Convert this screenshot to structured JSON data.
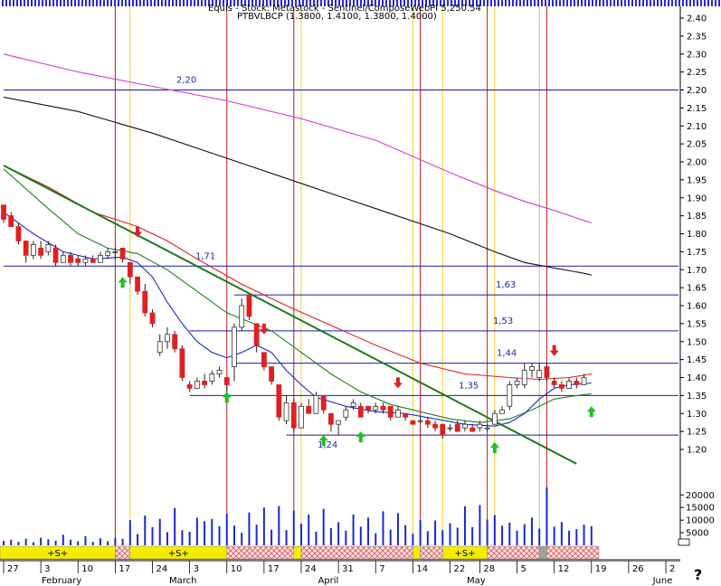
{
  "header": {
    "line1": "Equis - Stock: Metastock - Sentinel/ComposeWebPI 5,250.54",
    "line2": "PTBVLBCP (1.3800, 1.4100, 1.3800, 1.4000)"
  },
  "colors": {
    "background": "#ffffff",
    "up_candle": "#2a3cc0",
    "down_candle": "#e02020",
    "hline": "#1a1aa0",
    "ma_magenta": "#d040d0",
    "ma_black": "#101030",
    "ma_red": "#e02020",
    "ma_green": "#1f7f1f",
    "ma_blue": "#1a2ad0",
    "trendline": "#1e7a1e",
    "vline_red": "#c01818",
    "vline_yellow": "#f0d020",
    "volume": "#1a2ad0",
    "band_yellow": "#f4ec00",
    "band_hatch": "#e06060",
    "arrow_up": "#20c020",
    "arrow_down": "#e02020"
  },
  "chart_data": {
    "type": "candlestick",
    "title": "",
    "xlabel": "",
    "ylabel": "",
    "price_ylim": [
      1.15,
      2.45
    ],
    "price_ticks": [
      "2.40",
      "2.35",
      "2.30",
      "2.25",
      "2.20",
      "2.15",
      "2.10",
      "2.05",
      "2.00",
      "1.95",
      "1.90",
      "1.85",
      "1.80",
      "1.75",
      "1.70",
      "1.65",
      "1.60",
      "1.55",
      "1.50",
      "1.45",
      "1.40",
      "1.35",
      "1.30",
      "1.25",
      "1.20"
    ],
    "volume_ticks": [
      "20000",
      "15000",
      "10000",
      "5000"
    ],
    "volume_ylim": [
      0,
      28000
    ],
    "volume_tick_values": [
      20000,
      15000,
      10000,
      5000
    ],
    "x_day_labels": [
      "27",
      "3",
      "10",
      "17",
      "24",
      "3",
      "10",
      "17",
      "24",
      "31",
      "7",
      "14",
      "22",
      "28",
      "5",
      "12",
      "19",
      "26",
      "2"
    ],
    "x_day_index": [
      0,
      5,
      10,
      15,
      20,
      25,
      30,
      35,
      40,
      45,
      50,
      55,
      60,
      64,
      69,
      74,
      79,
      84,
      89
    ],
    "x_month_labels": [
      "February",
      "March",
      "April",
      "May",
      "June"
    ],
    "x_month_index": [
      2,
      22,
      42,
      62,
      87
    ],
    "n_slots": 92,
    "horizontal_levels": [
      {
        "value": 2.2,
        "label": "2,20",
        "from_index": 0
      },
      {
        "value": 1.71,
        "label": "1,71",
        "from_index": 0
      },
      {
        "value": 1.63,
        "label": "1,63",
        "from_index": 31
      },
      {
        "value": 1.53,
        "label": "1,53",
        "from_index": 25
      },
      {
        "value": 1.44,
        "label": "1,44",
        "from_index": 31
      },
      {
        "value": 1.35,
        "label": "1,35",
        "from_index": 25
      },
      {
        "value": 1.24,
        "label": "1,24",
        "from_index": 38
      }
    ],
    "ohlc": [
      [
        1.88,
        1.88,
        1.83,
        1.84
      ],
      [
        1.85,
        1.86,
        1.82,
        1.82
      ],
      [
        1.82,
        1.83,
        1.77,
        1.78
      ],
      [
        1.78,
        1.78,
        1.72,
        1.74
      ],
      [
        1.74,
        1.78,
        1.73,
        1.77
      ],
      [
        1.76,
        1.78,
        1.73,
        1.74
      ],
      [
        1.75,
        1.78,
        1.74,
        1.77
      ],
      [
        1.76,
        1.77,
        1.71,
        1.72
      ],
      [
        1.72,
        1.75,
        1.72,
        1.74
      ],
      [
        1.74,
        1.75,
        1.71,
        1.72
      ],
      [
        1.73,
        1.74,
        1.71,
        1.72
      ],
      [
        1.72,
        1.74,
        1.71,
        1.73
      ],
      [
        1.73,
        1.74,
        1.72,
        1.72
      ],
      [
        1.72,
        1.75,
        1.72,
        1.74
      ],
      [
        1.74,
        1.76,
        1.73,
        1.75
      ],
      [
        1.75,
        1.76,
        1.73,
        1.75
      ],
      [
        1.76,
        1.76,
        1.72,
        1.73
      ],
      [
        1.72,
        1.72,
        1.66,
        1.68
      ],
      [
        1.68,
        1.68,
        1.63,
        1.64
      ],
      [
        1.64,
        1.66,
        1.57,
        1.58
      ],
      [
        1.58,
        1.59,
        1.54,
        1.55
      ],
      [
        1.47,
        1.52,
        1.46,
        1.5
      ],
      [
        1.5,
        1.54,
        1.48,
        1.52
      ],
      [
        1.52,
        1.53,
        1.47,
        1.48
      ],
      [
        1.48,
        1.49,
        1.39,
        1.4
      ],
      [
        1.38,
        1.39,
        1.36,
        1.37
      ],
      [
        1.37,
        1.4,
        1.37,
        1.39
      ],
      [
        1.39,
        1.41,
        1.37,
        1.38
      ],
      [
        1.39,
        1.42,
        1.38,
        1.41
      ],
      [
        1.41,
        1.43,
        1.4,
        1.42
      ],
      [
        1.4,
        1.4,
        1.36,
        1.38
      ],
      [
        1.43,
        1.55,
        1.39,
        1.54
      ],
      [
        1.54,
        1.62,
        1.53,
        1.6
      ],
      [
        1.63,
        1.63,
        1.56,
        1.57
      ],
      [
        1.55,
        1.55,
        1.47,
        1.49
      ],
      [
        1.47,
        1.47,
        1.42,
        1.43
      ],
      [
        1.43,
        1.43,
        1.38,
        1.39
      ],
      [
        1.38,
        1.38,
        1.28,
        1.29
      ],
      [
        1.28,
        1.35,
        1.27,
        1.33
      ],
      [
        1.33,
        1.34,
        1.25,
        1.26
      ],
      [
        1.26,
        1.33,
        1.26,
        1.32
      ],
      [
        1.32,
        1.34,
        1.3,
        1.3
      ],
      [
        1.3,
        1.36,
        1.3,
        1.35
      ],
      [
        1.35,
        1.35,
        1.3,
        1.31
      ],
      [
        1.3,
        1.3,
        1.25,
        1.27
      ],
      [
        1.27,
        1.28,
        1.24,
        1.28
      ],
      [
        1.29,
        1.32,
        1.28,
        1.31
      ],
      [
        1.32,
        1.34,
        1.31,
        1.33
      ],
      [
        1.32,
        1.33,
        1.29,
        1.29
      ],
      [
        1.32,
        1.32,
        1.3,
        1.31
      ],
      [
        1.31,
        1.33,
        1.3,
        1.32
      ],
      [
        1.32,
        1.33,
        1.3,
        1.31
      ],
      [
        1.32,
        1.32,
        1.28,
        1.29
      ],
      [
        1.29,
        1.32,
        1.29,
        1.31
      ],
      [
        1.3,
        1.3,
        1.28,
        1.29
      ],
      [
        1.28,
        1.28,
        1.27,
        1.27
      ],
      [
        1.28,
        1.29,
        1.27,
        1.28
      ],
      [
        1.28,
        1.29,
        1.26,
        1.27
      ],
      [
        1.27,
        1.28,
        1.25,
        1.26
      ],
      [
        1.27,
        1.27,
        1.23,
        1.24
      ],
      [
        1.26,
        1.27,
        1.25,
        1.26
      ],
      [
        1.27,
        1.28,
        1.25,
        1.25
      ],
      [
        1.26,
        1.28,
        1.25,
        1.27
      ],
      [
        1.26,
        1.27,
        1.25,
        1.25
      ],
      [
        1.26,
        1.28,
        1.25,
        1.27
      ],
      [
        1.26,
        1.27,
        1.25,
        1.26
      ],
      [
        1.27,
        1.31,
        1.27,
        1.3
      ],
      [
        1.3,
        1.32,
        1.3,
        1.31
      ],
      [
        1.32,
        1.39,
        1.31,
        1.38
      ],
      [
        1.38,
        1.4,
        1.37,
        1.39
      ],
      [
        1.38,
        1.44,
        1.37,
        1.42
      ],
      [
        1.42,
        1.44,
        1.4,
        1.43
      ],
      [
        1.4,
        1.44,
        1.39,
        1.42
      ],
      [
        1.43,
        1.44,
        1.39,
        1.4
      ],
      [
        1.39,
        1.4,
        1.37,
        1.38
      ],
      [
        1.38,
        1.39,
        1.36,
        1.37
      ],
      [
        1.37,
        1.4,
        1.37,
        1.39
      ],
      [
        1.39,
        1.4,
        1.37,
        1.38
      ],
      [
        1.38,
        1.41,
        1.38,
        1.4
      ]
    ],
    "volume": [
      1800,
      2200,
      1400,
      2600,
      1200,
      3000,
      2400,
      1800,
      4200,
      2200,
      1600,
      3600,
      1400,
      2800,
      1600,
      3000,
      2600,
      10000,
      4500,
      11800,
      7200,
      10500,
      5200,
      14800,
      6000,
      5400,
      11000,
      9600,
      10500,
      7600,
      12500,
      7800,
      5000,
      13000,
      8200,
      15000,
      6200,
      15600,
      6000,
      13800,
      8600,
      12200,
      5400,
      14500,
      6800,
      9200,
      5800,
      12200,
      7400,
      11000,
      4800,
      13500,
      6200,
      12800,
      8000,
      4600,
      10000,
      5600,
      9800,
      6000,
      8800,
      7000,
      15500,
      7200,
      16000,
      10200,
      12000,
      7800,
      9000,
      5800,
      8400,
      11000,
      6600,
      23000,
      7400,
      9200,
      5800,
      6400,
      8200,
      7600
    ],
    "sma_short": [
      [
        0,
        1.86
      ],
      [
        4,
        1.8
      ],
      [
        8,
        1.75
      ],
      [
        12,
        1.73
      ],
      [
        16,
        1.735
      ],
      [
        18,
        1.72
      ],
      [
        20,
        1.68
      ],
      [
        22,
        1.61
      ],
      [
        24,
        1.55
      ],
      [
        26,
        1.5
      ],
      [
        28,
        1.47
      ],
      [
        30,
        1.455
      ],
      [
        32,
        1.47
      ],
      [
        34,
        1.49
      ],
      [
        36,
        1.47
      ],
      [
        38,
        1.42
      ],
      [
        40,
        1.38
      ],
      [
        42,
        1.345
      ],
      [
        46,
        1.32
      ],
      [
        50,
        1.305
      ],
      [
        54,
        1.3
      ],
      [
        58,
        1.285
      ],
      [
        62,
        1.27
      ],
      [
        66,
        1.265
      ],
      [
        68,
        1.275
      ],
      [
        70,
        1.3
      ],
      [
        72,
        1.34
      ],
      [
        74,
        1.37
      ],
      [
        76,
        1.38
      ],
      [
        79,
        1.385
      ]
    ],
    "sma_mid": [
      [
        0,
        1.98
      ],
      [
        6,
        1.87
      ],
      [
        10,
        1.8
      ],
      [
        14,
        1.76
      ],
      [
        18,
        1.745
      ],
      [
        22,
        1.7
      ],
      [
        26,
        1.64
      ],
      [
        30,
        1.58
      ],
      [
        33,
        1.555
      ],
      [
        36,
        1.53
      ],
      [
        40,
        1.47
      ],
      [
        44,
        1.41
      ],
      [
        48,
        1.36
      ],
      [
        52,
        1.325
      ],
      [
        56,
        1.305
      ],
      [
        60,
        1.285
      ],
      [
        64,
        1.275
      ],
      [
        68,
        1.285
      ],
      [
        71,
        1.31
      ],
      [
        74,
        1.34
      ],
      [
        77,
        1.35
      ],
      [
        79,
        1.355
      ]
    ],
    "sma_long": [
      [
        0,
        1.99
      ],
      [
        6,
        1.93
      ],
      [
        12,
        1.86
      ],
      [
        18,
        1.82
      ],
      [
        22,
        1.78
      ],
      [
        26,
        1.73
      ],
      [
        32,
        1.66
      ],
      [
        38,
        1.6
      ],
      [
        44,
        1.545
      ],
      [
        50,
        1.49
      ],
      [
        56,
        1.44
      ],
      [
        62,
        1.41
      ],
      [
        68,
        1.4
      ],
      [
        72,
        1.395
      ],
      [
        76,
        1.4
      ],
      [
        79,
        1.41
      ]
    ],
    "sma_150": [
      [
        0,
        2.18
      ],
      [
        10,
        2.14
      ],
      [
        20,
        2.08
      ],
      [
        30,
        2.01
      ],
      [
        40,
        1.94
      ],
      [
        50,
        1.87
      ],
      [
        60,
        1.8
      ],
      [
        66,
        1.75
      ],
      [
        70,
        1.72
      ],
      [
        74,
        1.705
      ],
      [
        78,
        1.69
      ],
      [
        79,
        1.685
      ]
    ],
    "sma_200": [
      [
        0,
        2.3
      ],
      [
        10,
        2.25
      ],
      [
        20,
        2.21
      ],
      [
        30,
        2.17
      ],
      [
        40,
        2.12
      ],
      [
        50,
        2.06
      ],
      [
        60,
        1.97
      ],
      [
        66,
        1.92
      ],
      [
        70,
        1.89
      ],
      [
        74,
        1.865
      ],
      [
        79,
        1.83
      ]
    ],
    "trendline": [
      [
        0,
        1.99
      ],
      [
        77,
        1.16
      ]
    ],
    "vlines_red": [
      15,
      30,
      39,
      56,
      65,
      73
    ],
    "vlines_yellow": [
      17,
      40,
      55,
      59,
      66
    ],
    "vlines_gray": [
      72
    ],
    "arrows_up": [
      [
        16,
        1.68
      ],
      [
        30,
        1.36
      ],
      [
        43,
        1.24
      ],
      [
        48,
        1.25
      ],
      [
        66,
        1.22
      ],
      [
        79,
        1.32
      ]
    ],
    "arrows_down": [
      [
        18,
        1.79
      ],
      [
        35,
        1.52
      ],
      [
        53,
        1.37
      ],
      [
        74,
        1.46
      ]
    ],
    "bands": [
      {
        "from": 0,
        "to": 15,
        "kind": "yellow",
        "label": "+S+"
      },
      {
        "from": 15,
        "to": 17,
        "kind": "hatch",
        "label": ""
      },
      {
        "from": 17,
        "to": 30,
        "kind": "yellow",
        "label": "+S+"
      },
      {
        "from": 30,
        "to": 39,
        "kind": "hatch",
        "label": ""
      },
      {
        "from": 39,
        "to": 40,
        "kind": "yellow",
        "label": ""
      },
      {
        "from": 40,
        "to": 55,
        "kind": "hatch",
        "label": ""
      },
      {
        "from": 55,
        "to": 56,
        "kind": "yellow",
        "label": ""
      },
      {
        "from": 56,
        "to": 59,
        "kind": "hatch",
        "label": ""
      },
      {
        "from": 59,
        "to": 65,
        "kind": "yellow",
        "label": "+S+"
      },
      {
        "from": 65,
        "to": 72,
        "kind": "hatch",
        "label": ""
      },
      {
        "from": 72,
        "to": 73,
        "kind": "gray",
        "label": ""
      },
      {
        "from": 73,
        "to": 80,
        "kind": "hatch",
        "label": ""
      }
    ],
    "corner_mark": "?",
    "grid": false,
    "legend": "none"
  }
}
